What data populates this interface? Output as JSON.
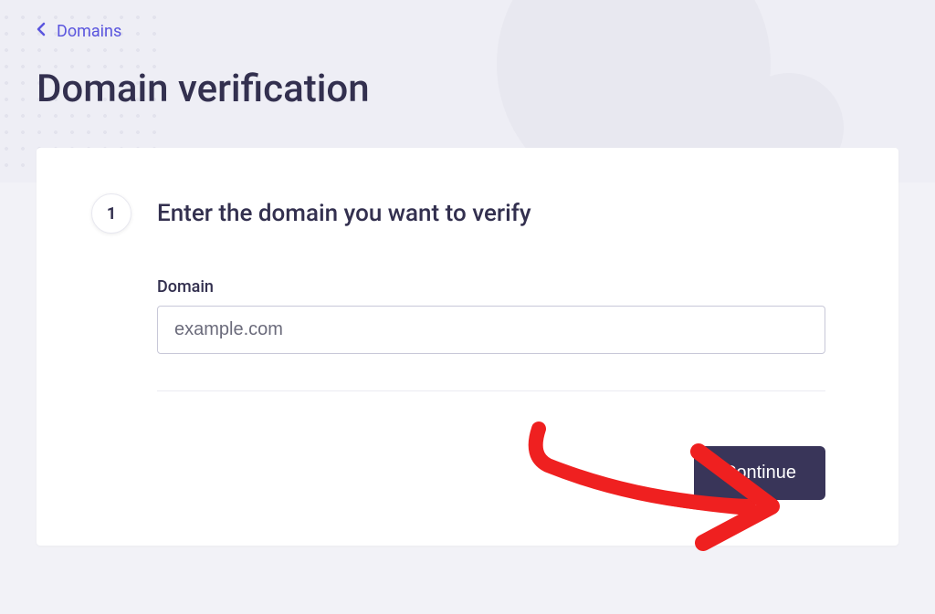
{
  "breadcrumb": {
    "back_label": "Domains"
  },
  "page": {
    "title": "Domain verification"
  },
  "step": {
    "number": "1",
    "title": "Enter the domain you want to verify"
  },
  "form": {
    "domain_label": "Domain",
    "domain_value": "example.com",
    "domain_placeholder": "example.com"
  },
  "actions": {
    "continue_label": "Continue"
  }
}
